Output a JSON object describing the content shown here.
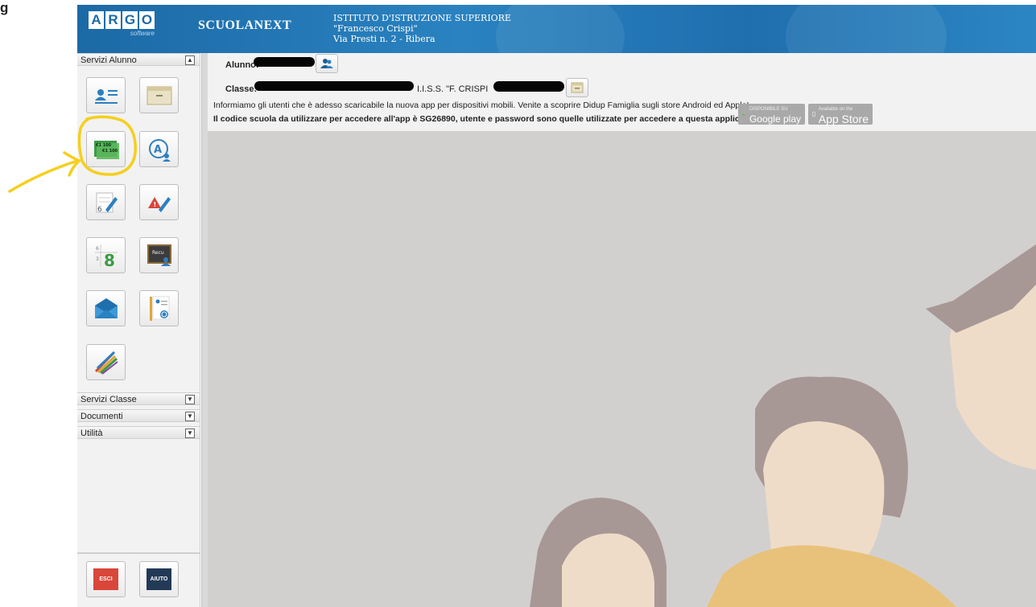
{
  "ghost_label": "g",
  "header": {
    "logo_letters": [
      "A",
      "R",
      "G",
      "O"
    ],
    "logo_sub": "software",
    "brand": "SCUOLANEXT",
    "school_lines": [
      "ISTITUTO D'ISTRUZIONE SUPERIORE",
      "\"Francesco Crispi\"",
      "Via Presti n. 2 - Ribera"
    ]
  },
  "sidebar": {
    "sections": [
      {
        "label": "Servizi Alunno",
        "toggle": "▲"
      },
      {
        "label": "Servizi Classe",
        "toggle": "▼"
      },
      {
        "label": "Documenti",
        "toggle": "▼"
      },
      {
        "label": "Utilità",
        "toggle": "▼"
      }
    ],
    "tiles": [
      {
        "icon": "student-card-icon"
      },
      {
        "icon": "register-icon"
      },
      {
        "icon": "fees-payment-icon",
        "text_a": "€1 100",
        "text_b": "€1 100"
      },
      {
        "icon": "absences-icon"
      },
      {
        "icon": "grades-icon",
        "text": "6"
      },
      {
        "icon": "notes-icon"
      },
      {
        "icon": "scrutiny-icon",
        "text": "8"
      },
      {
        "icon": "recovery-icon",
        "text": "Recu"
      },
      {
        "icon": "messages-icon"
      },
      {
        "icon": "teachers-icon"
      },
      {
        "icon": "bulletin-icon"
      }
    ],
    "bottom_buttons": [
      {
        "label": "ESCI",
        "color": "#d9463a"
      },
      {
        "label": "AIUTO",
        "color": "#233a57"
      }
    ]
  },
  "main": {
    "alunno_label": "Alunno:",
    "classe_label": "Classe:",
    "classe_suffix": "I.I.S.S. \"F. CRISPI",
    "info_line1": "Informiamo gli utenti che è adesso scaricabile la nuova app per dispositivi mobili. Venite a scoprire Didup Famiglia sugli store Android ed Apple!",
    "info_line2": "Il codice scuola da utilizzare per accedere all'app è SG26890, utente e password sono quelle utilizzate per accedere a questa applicazione.",
    "google_play": {
      "small": "DISPONIBILE SU",
      "label": "Google play"
    },
    "app_store": {
      "small": "Available on the",
      "label": "App Store"
    }
  },
  "colors": {
    "header_blue": "#1b6aa6",
    "annotation_yellow": "#f5cf1e",
    "background_gray": "#d2d0cf"
  }
}
